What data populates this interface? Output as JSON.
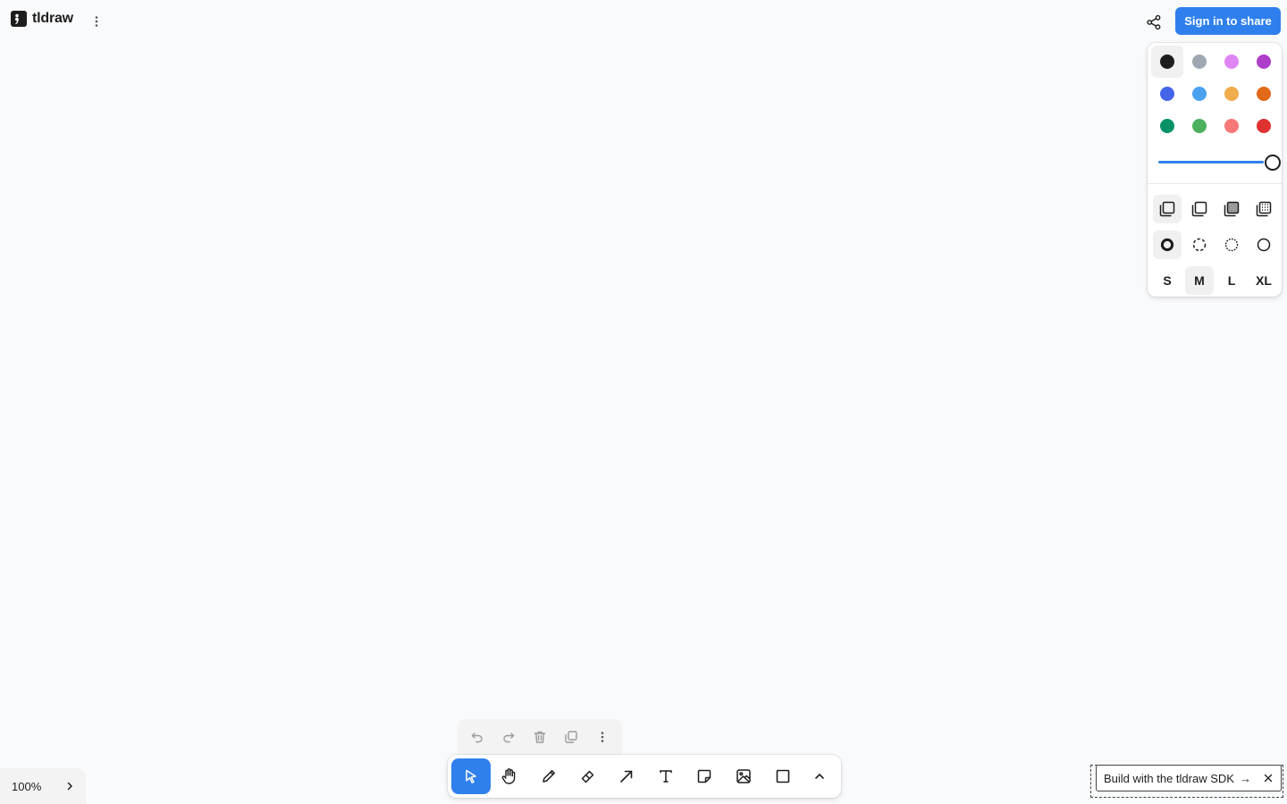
{
  "app": {
    "name": "tldraw"
  },
  "header": {
    "main_menu_icon": "more-vertical-icon",
    "share_icon": "share-icon",
    "sign_in_label": "Sign in to share",
    "sign_in_color": "#2f80ed"
  },
  "style_panel": {
    "colors": [
      {
        "name": "black",
        "hex": "#1d1d1d",
        "selected": true
      },
      {
        "name": "grey",
        "hex": "#9fa8b2",
        "selected": false
      },
      {
        "name": "light-violet",
        "hex": "#e085f4",
        "selected": false
      },
      {
        "name": "violet",
        "hex": "#ae3ec9",
        "selected": false
      },
      {
        "name": "blue",
        "hex": "#4465e9",
        "selected": false
      },
      {
        "name": "light-blue",
        "hex": "#4ba1f1",
        "selected": false
      },
      {
        "name": "yellow",
        "hex": "#f1ac4b",
        "selected": false
      },
      {
        "name": "orange",
        "hex": "#e16919",
        "selected": false
      },
      {
        "name": "green",
        "hex": "#099268",
        "selected": false
      },
      {
        "name": "light-green",
        "hex": "#4cb05e",
        "selected": false
      },
      {
        "name": "light-red",
        "hex": "#f87777",
        "selected": false
      },
      {
        "name": "red",
        "hex": "#e03131",
        "selected": false
      }
    ],
    "opacity": 1.0,
    "fill_options": [
      {
        "name": "fill-none-icon",
        "selected": true
      },
      {
        "name": "fill-semi-icon",
        "selected": false
      },
      {
        "name": "fill-solid-icon",
        "selected": false
      },
      {
        "name": "fill-pattern-icon",
        "selected": false
      }
    ],
    "dash_options": [
      {
        "name": "dash-draw-icon",
        "selected": true
      },
      {
        "name": "dash-dashed-icon",
        "selected": false
      },
      {
        "name": "dash-dotted-icon",
        "selected": false
      },
      {
        "name": "dash-solid-icon",
        "selected": false
      }
    ],
    "sizes": [
      {
        "label": "S",
        "selected": false
      },
      {
        "label": "M",
        "selected": true
      },
      {
        "label": "L",
        "selected": false
      },
      {
        "label": "XL",
        "selected": false
      }
    ]
  },
  "quick_actions": [
    "undo-icon",
    "redo-icon",
    "trash-icon",
    "duplicate-icon",
    "more-icon"
  ],
  "toolbar": {
    "tools": [
      {
        "name": "select",
        "icon": "cursor-icon",
        "selected": true
      },
      {
        "name": "hand",
        "icon": "hand-icon",
        "selected": false
      },
      {
        "name": "draw",
        "icon": "pencil-icon",
        "selected": false
      },
      {
        "name": "eraser",
        "icon": "eraser-icon",
        "selected": false
      },
      {
        "name": "arrow",
        "icon": "arrow-icon",
        "selected": false
      },
      {
        "name": "text",
        "icon": "text-icon",
        "selected": false
      },
      {
        "name": "note",
        "icon": "note-icon",
        "selected": false
      },
      {
        "name": "asset",
        "icon": "image-icon",
        "selected": false
      },
      {
        "name": "rectangle",
        "icon": "rectangle-icon",
        "selected": false
      }
    ],
    "more_icon": "chevron-up-icon"
  },
  "zoom": {
    "label": "100%"
  },
  "promo": {
    "label": "Build with the tldraw SDK",
    "arrow": "→"
  }
}
